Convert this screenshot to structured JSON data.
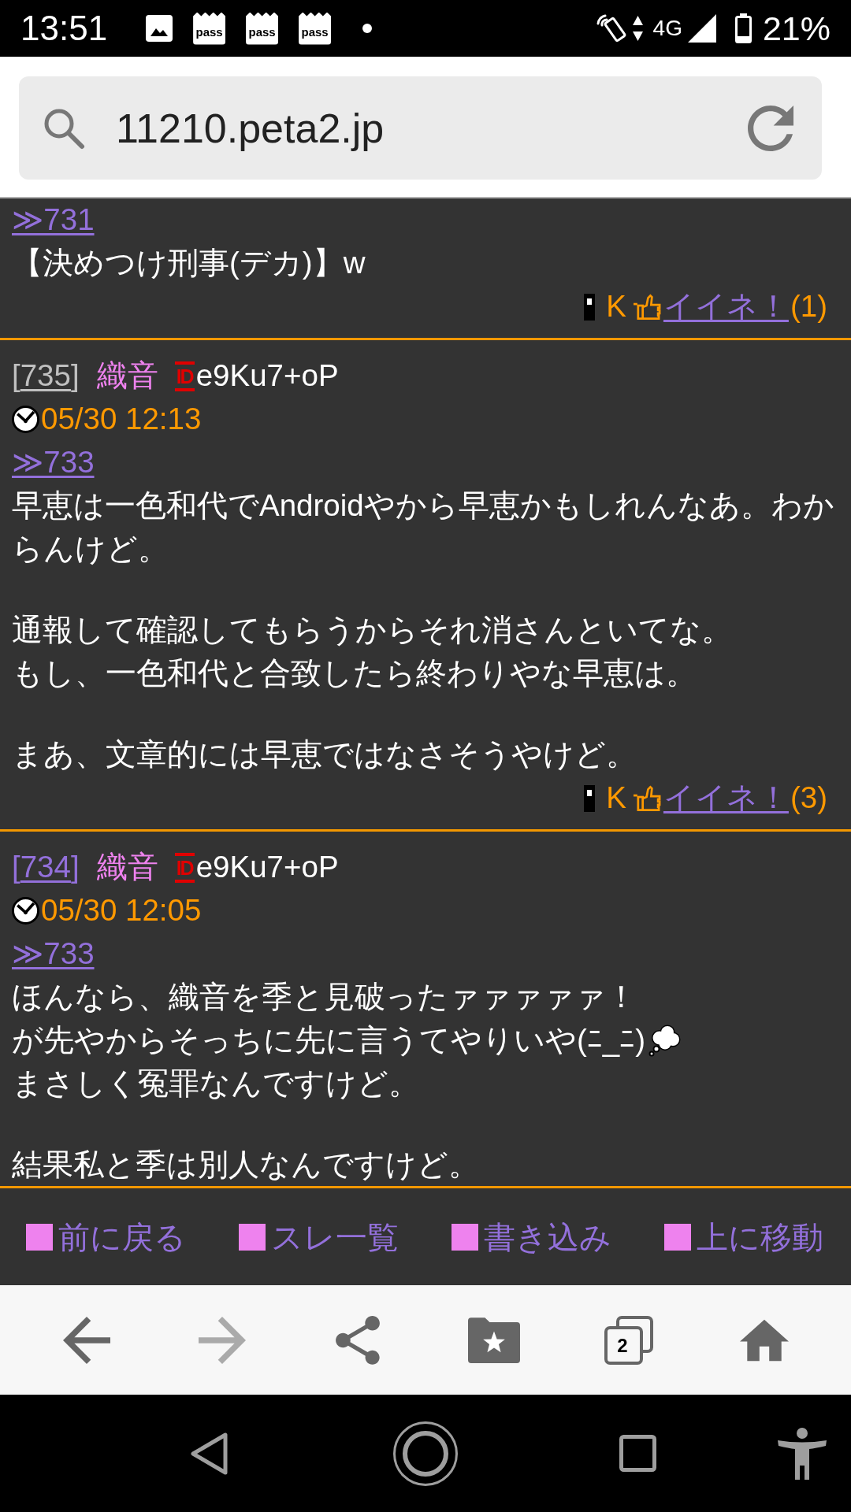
{
  "status_bar": {
    "time": "13:51",
    "notifications": [
      {
        "kind": "image"
      },
      {
        "kind": "ticket",
        "label": "pass"
      },
      {
        "kind": "ticket",
        "label": "pass"
      },
      {
        "kind": "ticket",
        "label": "pass"
      },
      {
        "kind": "dot"
      }
    ],
    "network": "4G",
    "battery": "21%"
  },
  "address_bar": {
    "url": "11210.peta2.jp"
  },
  "posts": [
    {
      "reply_to": "≫731",
      "paragraphs": [
        [
          {
            "text": "【決めつけ刑事(デカ)】w"
          }
        ]
      ],
      "footer": {
        "carrier": "K",
        "like_label": "イイネ！",
        "like_count": "(1)"
      }
    },
    {
      "number": "[735]",
      "visited": true,
      "name": "織音",
      "id_mark": "ID",
      "id": "e9Ku7+oP",
      "date": "05/30 12:13",
      "reply_to": "≫733",
      "paragraphs": [
        [
          {
            "text": "早恵は一色和代でAndroidやから早恵かもしれんなあ。わか"
          },
          {
            "text": "らんけど。"
          }
        ],
        [
          {
            "text": "通報して確認してもらうからそれ消さんといてな。"
          },
          {
            "text": "もし、一色和代と合致したら終わりやな早恵は。"
          }
        ],
        [
          {
            "text": "まあ、文章的には早恵ではなさそうやけど。"
          }
        ]
      ],
      "footer": {
        "carrier": "K",
        "like_label": "イイネ！",
        "like_count": "(3)"
      }
    },
    {
      "number": "[734]",
      "visited": false,
      "name": "織音",
      "id_mark": "ID",
      "id": "e9Ku7+oP",
      "date": "05/30 12:05",
      "reply_to": "≫733",
      "paragraphs": [
        [
          {
            "text": "ほんなら、織音を季と見破ったァァァァァ！"
          },
          {
            "text": "が先やからそっちに先に言うてやりいや(ﾆ_ﾆ)",
            "emoji": true
          },
          {
            "text": "まさしく冤罪なんですけど。"
          }
        ],
        [
          {
            "text": "結果私と季は別人なんですけど。"
          }
        ]
      ]
    }
  ],
  "bottom_nav": [
    {
      "label": "前に戻る"
    },
    {
      "label": "スレ一覧"
    },
    {
      "label": "書き込み"
    },
    {
      "label": "上に移動"
    }
  ],
  "toolbar": [
    {
      "kind": "back",
      "disabled": false
    },
    {
      "kind": "forward",
      "disabled": true
    },
    {
      "kind": "share",
      "disabled": false
    },
    {
      "kind": "bookmarks",
      "disabled": false
    },
    {
      "kind": "tabs",
      "disabled": false,
      "count": "2"
    },
    {
      "kind": "home",
      "disabled": false
    }
  ]
}
